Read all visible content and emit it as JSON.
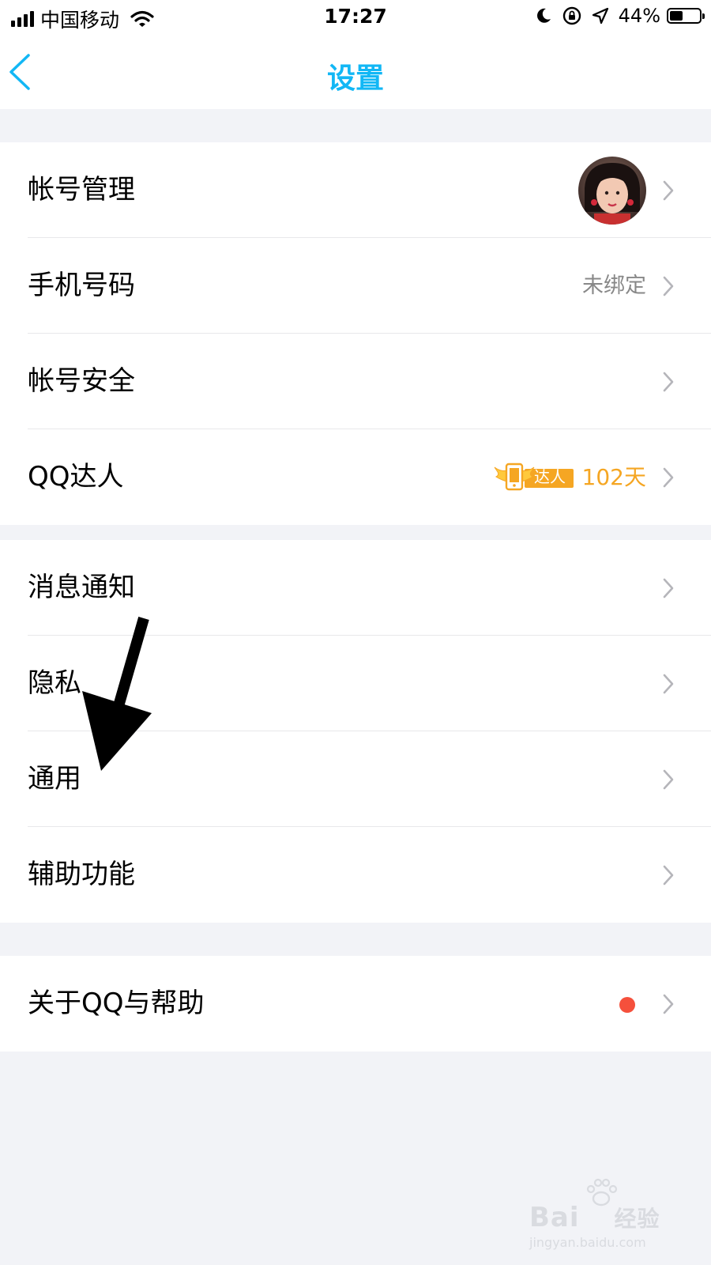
{
  "status_bar": {
    "carrier": "中国移动",
    "time": "17:27",
    "battery": "44%",
    "battery_level": 0.44
  },
  "nav": {
    "title": "设置"
  },
  "groups": [
    {
      "rows": [
        {
          "label": "帐号管理"
        },
        {
          "label": "手机号码",
          "value": "未绑定"
        },
        {
          "label": "帐号安全"
        },
        {
          "label": "QQ达人",
          "badge": "达人",
          "value": "102天"
        }
      ]
    },
    {
      "rows": [
        {
          "label": "消息通知"
        },
        {
          "label": "隐私"
        },
        {
          "label": "通用"
        },
        {
          "label": "辅助功能"
        }
      ]
    },
    {
      "rows": [
        {
          "label": "关于QQ与帮助"
        }
      ]
    }
  ],
  "watermark": {
    "brand": "Bai",
    "brand_cn": "经验",
    "url": "jingyan.baidu.com"
  },
  "colors": {
    "accent": "#12b7f5",
    "gold": "#f5a623",
    "red_dot": "#f5503c",
    "background": "#f2f3f7"
  }
}
